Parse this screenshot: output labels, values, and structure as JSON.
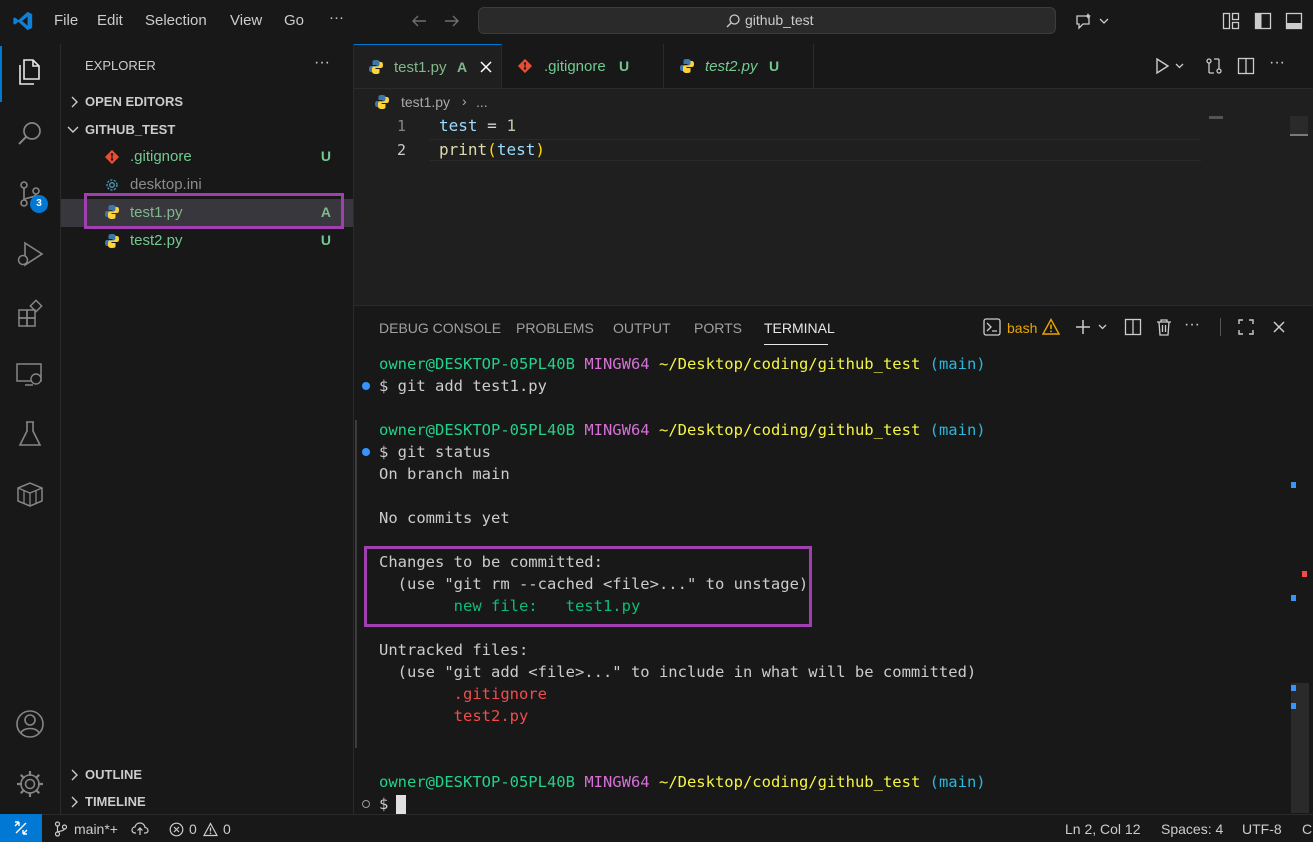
{
  "titlebar": {
    "menu": [
      "File",
      "Edit",
      "Selection",
      "View",
      "Go",
      "···"
    ],
    "search_text": "github_test"
  },
  "activity": {
    "scm_badge": "3"
  },
  "sidebar": {
    "title": "EXPLORER",
    "more": "···",
    "open_editors": "OPEN EDITORS",
    "folder": "GITHUB_TEST",
    "files": [
      {
        "name": ".gitignore",
        "status": "U",
        "color": "#73c991",
        "icon": "git-icon"
      },
      {
        "name": "desktop.ini",
        "status": "",
        "color": "#8c8c8c",
        "icon": "gear-icon"
      },
      {
        "name": "test1.py",
        "status": "A",
        "color": "#81b88b",
        "icon": "python-icon"
      },
      {
        "name": "test2.py",
        "status": "U",
        "color": "#73c991",
        "icon": "python-icon"
      }
    ],
    "outline": "OUTLINE",
    "timeline": "TIMELINE"
  },
  "tabs": [
    {
      "label": "test1.py",
      "status": "A"
    },
    {
      "label": ".gitignore",
      "status": "U"
    },
    {
      "label": "test2.py",
      "status": "U"
    }
  ],
  "breadcrumb": {
    "file": "test1.py",
    "sep": "›",
    "more": "..."
  },
  "editor": {
    "line_numbers": [
      "1",
      "2"
    ],
    "line1": {
      "var": "test",
      "op": " = ",
      "num": "1"
    },
    "line2": {
      "fn": "print",
      "open": "(",
      "arg": "test",
      "close": ")"
    }
  },
  "panel": {
    "tabs": [
      "DEBUG CONSOLE",
      "PROBLEMS",
      "OUTPUT",
      "PORTS",
      "TERMINAL"
    ],
    "shell": "bash"
  },
  "terminal": {
    "prompt": {
      "user": "owner@DESKTOP-05PL40B",
      "env": "MINGW64",
      "path": "~/Desktop/coding/github_test",
      "branch": "(main)"
    },
    "cmd1": "$ git add test1.py",
    "cmd2": "$ git status",
    "out_branch": "On branch main",
    "out_nocommits": "No commits yet",
    "out_changes": "Changes to be committed:",
    "out_unstage": "  (use \"git rm --cached <file>...\" to unstage)",
    "out_newfile": "        new file:   test1.py",
    "out_untracked": "Untracked files:",
    "out_include": "  (use \"git add <file>...\" to include in what will be committed)",
    "out_u1": "        .gitignore",
    "out_u2": "        test2.py",
    "cmd3": "$ "
  },
  "statusbar": {
    "branch": "main*+",
    "errors": "0",
    "warnings": "0",
    "position": "Ln 2, Col 12",
    "spaces": "Spaces: 4",
    "encoding": "UTF-8",
    "eol": "CI"
  }
}
